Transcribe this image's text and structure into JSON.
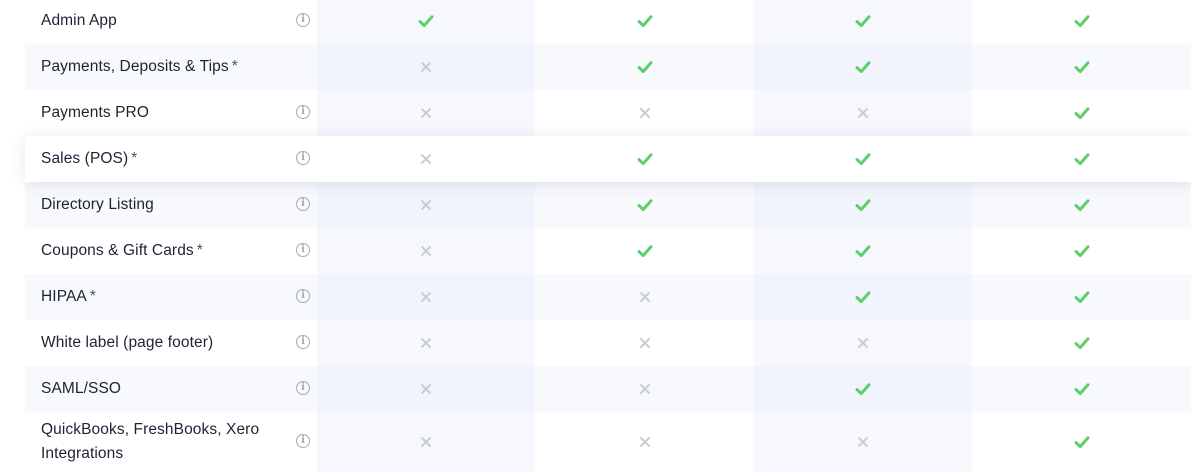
{
  "colors": {
    "check": "#5ccf6a",
    "cross": "#c9cdd6",
    "info": "#a4a9b3"
  },
  "features": [
    {
      "label": "Admin App",
      "asterisk": "",
      "info": true,
      "plans": [
        true,
        true,
        true,
        true
      ]
    },
    {
      "label": "Payments, Deposits & Tips",
      "asterisk": "*",
      "info": false,
      "plans": [
        false,
        true,
        true,
        true
      ]
    },
    {
      "label": "Payments PRO",
      "asterisk": "",
      "info": true,
      "plans": [
        false,
        false,
        false,
        true
      ]
    },
    {
      "label": "Sales (POS)",
      "asterisk": "*",
      "info": true,
      "plans": [
        false,
        true,
        true,
        true
      ]
    },
    {
      "label": "Directory Listing",
      "asterisk": "",
      "info": true,
      "plans": [
        false,
        true,
        true,
        true
      ]
    },
    {
      "label": "Coupons & Gift Cards",
      "asterisk": "*",
      "info": true,
      "plans": [
        false,
        true,
        true,
        true
      ]
    },
    {
      "label": "HIPAA",
      "asterisk": "*",
      "info": true,
      "plans": [
        false,
        false,
        true,
        true
      ]
    },
    {
      "label": "White label (page footer)",
      "asterisk": "",
      "info": true,
      "plans": [
        false,
        false,
        false,
        true
      ]
    },
    {
      "label": "SAML/SSO",
      "asterisk": "",
      "info": true,
      "plans": [
        false,
        false,
        true,
        true
      ]
    },
    {
      "label": "QuickBooks, FreshBooks, Xero Integrations",
      "asterisk": "",
      "info": true,
      "plans": [
        false,
        false,
        false,
        true
      ]
    }
  ]
}
